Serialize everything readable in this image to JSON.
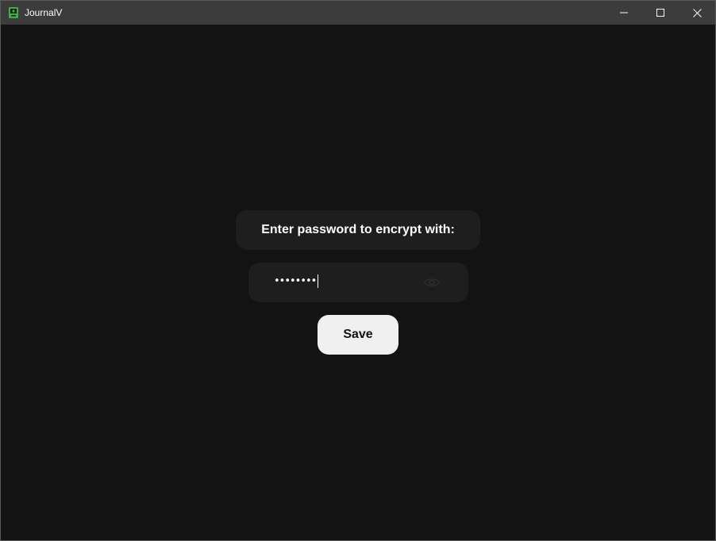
{
  "window": {
    "title": "JournalV",
    "controls": {
      "minimize_icon": "minimize-icon",
      "maximize_icon": "maximize-icon",
      "close_icon": "close-icon"
    }
  },
  "dialog": {
    "prompt": "Enter password to encrypt with:",
    "password_value": "••••••••",
    "visibility_icon": "eye-icon",
    "save_label": "Save"
  },
  "colors": {
    "background": "#131313",
    "titlebar": "#3c3c3c",
    "panel": "#1e1e1e",
    "button": "#f0f0f0",
    "app_icon_green": "#3cb043"
  }
}
